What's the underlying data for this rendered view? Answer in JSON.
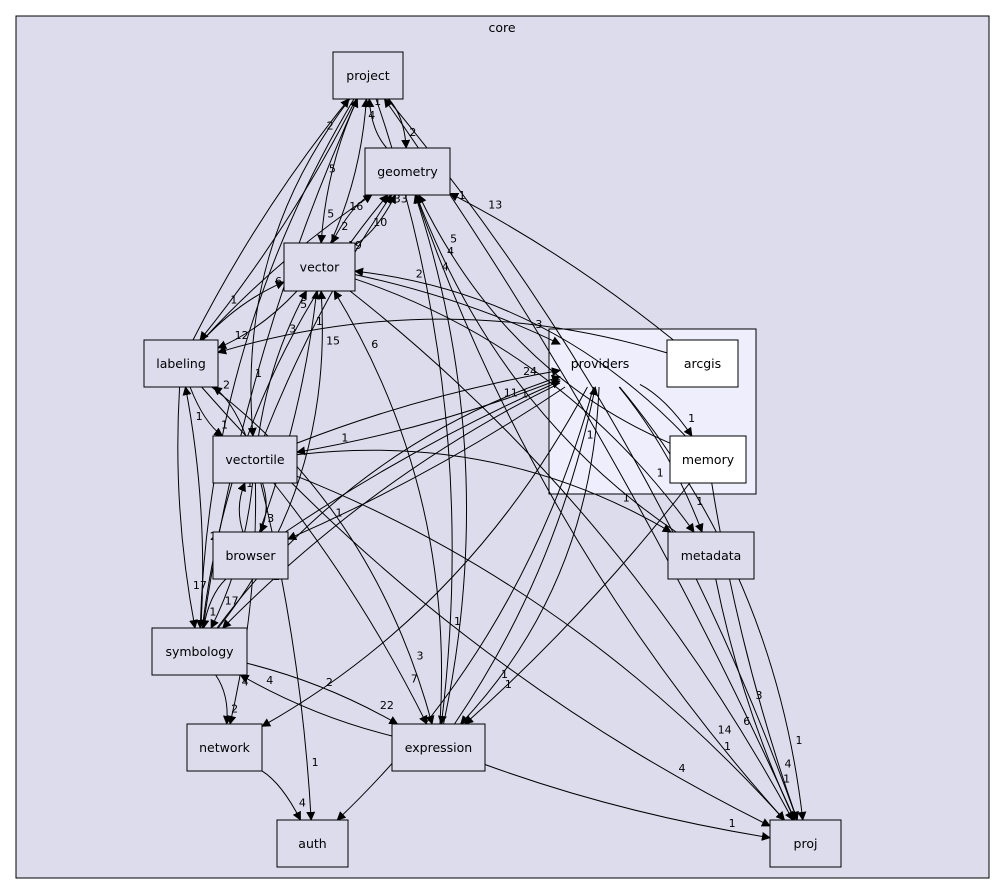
{
  "diagram": {
    "title": "core",
    "colors": {
      "cluster_fill": "#dcdcec",
      "cluster_stroke": "#000000",
      "subcluster_fill": "#eeeefc",
      "node_fill": "#dcdcec",
      "node_fill_white": "#ffffff",
      "edge": "#000000"
    },
    "nodes": [
      {
        "id": "project",
        "label": "project"
      },
      {
        "id": "geometry",
        "label": "geometry"
      },
      {
        "id": "vector",
        "label": "vector"
      },
      {
        "id": "labeling",
        "label": "labeling"
      },
      {
        "id": "providers",
        "label": "providers"
      },
      {
        "id": "arcgis",
        "label": "arcgis"
      },
      {
        "id": "memory",
        "label": "memory"
      },
      {
        "id": "vectortile",
        "label": "vectortile"
      },
      {
        "id": "browser",
        "label": "browser"
      },
      {
        "id": "metadata",
        "label": "metadata"
      },
      {
        "id": "symbology",
        "label": "symbology"
      },
      {
        "id": "network",
        "label": "network"
      },
      {
        "id": "expression",
        "label": "expression"
      },
      {
        "id": "auth",
        "label": "auth"
      },
      {
        "id": "proj",
        "label": "proj"
      }
    ],
    "edges": [
      {
        "from": "project",
        "to": "geometry",
        "label": "2"
      },
      {
        "from": "geometry",
        "to": "project",
        "label": "1"
      },
      {
        "from": "project",
        "to": "vector",
        "label": "5"
      },
      {
        "from": "vector",
        "to": "project",
        "label": "4"
      },
      {
        "from": "project",
        "to": "labeling",
        "label": "1"
      },
      {
        "from": "labeling",
        "to": "project",
        "label": "2"
      },
      {
        "from": "project",
        "to": "vectortile",
        "label": "1"
      },
      {
        "from": "project",
        "to": "symbology",
        "label": "2"
      },
      {
        "from": "symbology",
        "to": "project",
        "label": "5"
      },
      {
        "from": "project",
        "to": "expression",
        "label": "1"
      },
      {
        "from": "project",
        "to": "proj",
        "label": "3"
      },
      {
        "from": "proj",
        "to": "project",
        "label": "1"
      },
      {
        "from": "geometry",
        "to": "vector",
        "label": "2"
      },
      {
        "from": "vector",
        "to": "geometry",
        "label": "33"
      },
      {
        "from": "labeling",
        "to": "geometry",
        "label": "16"
      },
      {
        "from": "vectortile",
        "to": "geometry",
        "label": "10"
      },
      {
        "from": "symbology",
        "to": "geometry",
        "label": "19"
      },
      {
        "from": "arcgis",
        "to": "geometry",
        "label": "13"
      },
      {
        "from": "memory",
        "to": "geometry",
        "label": "5"
      },
      {
        "from": "expression",
        "to": "geometry",
        "label": "4"
      },
      {
        "from": "metadata",
        "to": "geometry",
        "label": "4"
      },
      {
        "from": "geometry",
        "to": "proj",
        "label": "14"
      },
      {
        "from": "vector",
        "to": "providers",
        "label": "3"
      },
      {
        "from": "vector",
        "to": "labeling",
        "label": "12"
      },
      {
        "from": "labeling",
        "to": "vector",
        "label": "6"
      },
      {
        "from": "vectortile",
        "to": "vector",
        "label": "5"
      },
      {
        "from": "browser",
        "to": "vector",
        "label": "1"
      },
      {
        "from": "symbology",
        "to": "vector",
        "label": "15"
      },
      {
        "from": "expression",
        "to": "vector",
        "label": "6"
      },
      {
        "from": "memory",
        "to": "vector",
        "label": "2"
      },
      {
        "from": "vector",
        "to": "metadata",
        "label": "1"
      },
      {
        "from": "vector",
        "to": "proj",
        "label": "6"
      },
      {
        "from": "arcgis",
        "to": "labeling",
        "label": "3"
      },
      {
        "from": "labeling",
        "to": "vectortile",
        "label": "1"
      },
      {
        "from": "vectortile",
        "to": "labeling",
        "label": "2"
      },
      {
        "from": "labeling",
        "to": "symbology",
        "label": "17"
      },
      {
        "from": "symbology",
        "to": "labeling",
        "label": "1"
      },
      {
        "from": "labeling",
        "to": "expression",
        "label": "3"
      },
      {
        "from": "labeling",
        "to": "proj",
        "label": "4"
      },
      {
        "from": "vectortile",
        "to": "providers",
        "label": "24"
      },
      {
        "from": "providers",
        "to": "vectortile",
        "label": "1"
      },
      {
        "from": "vectortile",
        "to": "browser",
        "label": "3"
      },
      {
        "from": "browser",
        "to": "vectortile",
        "label": "1"
      },
      {
        "from": "vectortile",
        "to": "symbology",
        "label": "17"
      },
      {
        "from": "vectortile",
        "to": "metadata",
        "label": "1"
      },
      {
        "from": "vectortile",
        "to": "network",
        "label": "4"
      },
      {
        "from": "vectortile",
        "to": "expression",
        "label": "7"
      },
      {
        "from": "vectortile",
        "to": "auth",
        "label": "1"
      },
      {
        "from": "vectortile",
        "to": "proj",
        "label": "1"
      },
      {
        "from": "providers",
        "to": "browser",
        "label": "1"
      },
      {
        "from": "browser",
        "to": "providers",
        "label": "1"
      },
      {
        "from": "browser",
        "to": "symbology",
        "label": "1"
      },
      {
        "from": "symbology",
        "to": "providers",
        "label": "11"
      },
      {
        "from": "providers",
        "to": "symbology",
        "label": "2"
      },
      {
        "from": "providers",
        "to": "memory",
        "label": "1"
      },
      {
        "from": "providers",
        "to": "metadata",
        "label": "1"
      },
      {
        "from": "providers",
        "to": "network",
        "label": "2"
      },
      {
        "from": "providers",
        "to": "expression",
        "label": "1"
      },
      {
        "from": "expression",
        "to": "providers",
        "label": "1"
      },
      {
        "from": "providers",
        "to": "auth",
        "label": "1"
      },
      {
        "from": "providers",
        "to": "proj",
        "label": "1"
      },
      {
        "from": "memory",
        "to": "expression",
        "label": "1"
      },
      {
        "from": "memory",
        "to": "proj",
        "label": "4"
      },
      {
        "from": "metadata",
        "to": "proj",
        "label": "1"
      },
      {
        "from": "symbology",
        "to": "expression",
        "label": "22"
      },
      {
        "from": "expression",
        "to": "symbology",
        "label": "4"
      },
      {
        "from": "symbology",
        "to": "network",
        "label": "2"
      },
      {
        "from": "network",
        "to": "auth",
        "label": "4"
      },
      {
        "from": "expression",
        "to": "proj",
        "label": "1"
      }
    ]
  }
}
